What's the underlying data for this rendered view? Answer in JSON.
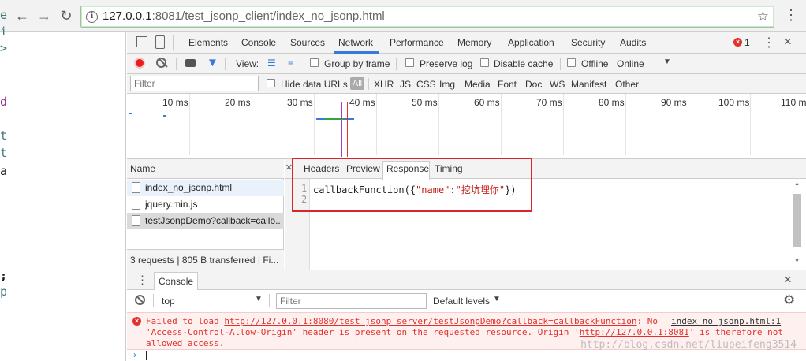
{
  "browser": {
    "url_host": "127.0.0.1",
    "url_rest": ":8081/test_jsonp_client/index_no_jsonp.html",
    "back_icon": "arrow-left-icon",
    "forward_icon": "arrow-right-icon",
    "reload_icon": "reload-icon",
    "star_icon": "star-icon",
    "menu_icon": "kebab-menu-icon"
  },
  "page_fragments": [
    "e",
    "i",
    ">",
    "d",
    "t",
    "t",
    "a",
    ";",
    "p"
  ],
  "devtools": {
    "tabs": [
      "Elements",
      "Console",
      "Sources",
      "Network",
      "Performance",
      "Memory",
      "Application",
      "Security",
      "Audits"
    ],
    "active_tab": "Network",
    "error_count": "1",
    "toolbar": {
      "view_label": "View:",
      "group_by_frame": "Group by frame",
      "preserve_log": "Preserve log",
      "disable_cache": "Disable cache",
      "offline": "Offline",
      "throttle": "Online"
    },
    "filter": {
      "placeholder": "Filter",
      "hide_data_urls": "Hide data URLs",
      "all": "All",
      "types": [
        "XHR",
        "JS",
        "CSS",
        "Img",
        "Media",
        "Font",
        "Doc",
        "WS",
        "Manifest",
        "Other"
      ]
    },
    "timeline_ticks": [
      "10 ms",
      "20 ms",
      "30 ms",
      "40 ms",
      "50 ms",
      "60 ms",
      "70 ms",
      "80 ms",
      "90 ms",
      "100 ms",
      "110 ms"
    ],
    "name_header": "Name",
    "requests": [
      {
        "name": "index_no_jsonp.html",
        "selected": false,
        "highlight": true
      },
      {
        "name": "jquery.min.js",
        "selected": false,
        "highlight": false
      },
      {
        "name": "testJsonpDemo?callback=callb...",
        "selected": true,
        "highlight": false
      }
    ],
    "summary": "3 requests  |  805 B transferred  |  Fi...",
    "response_tabs": [
      "Headers",
      "Preview",
      "Response",
      "Timing"
    ],
    "active_response_tab": "Response",
    "response_code": {
      "line_numbers": [
        "1",
        "2"
      ],
      "prefix": "callbackFunction({",
      "key": "\"name\"",
      "colon": ":",
      "value": "\"挖坑埋你\"",
      "suffix": "})"
    },
    "drawer": {
      "tab": "Console",
      "context": "top",
      "filter_placeholder": "Filter",
      "levels": "Default levels"
    },
    "error": {
      "line1_prefix": "Failed to load ",
      "line1_url": "http://127.0.0.1:8080/test_jsonp_server/testJsonpDemo?callback=callbackFunction",
      "line1_suffix": ": No",
      "source": "index_no_jsonp.html:1",
      "line2_prefix": "'Access-Control-Allow-Origin' header is present on the requested resource. Origin '",
      "line2_url": "http://127.0.0.1:8081",
      "line2_suffix": "' is therefore not",
      "line3": "allowed access."
    },
    "watermark": "http://blog.csdn.net/liupeifeng3514"
  },
  "colors": {
    "accent": "#3879d9",
    "error": "#e0312c",
    "highlight_box": "#d8262e",
    "string": "#c41a16",
    "selected_row": "#dadada"
  }
}
